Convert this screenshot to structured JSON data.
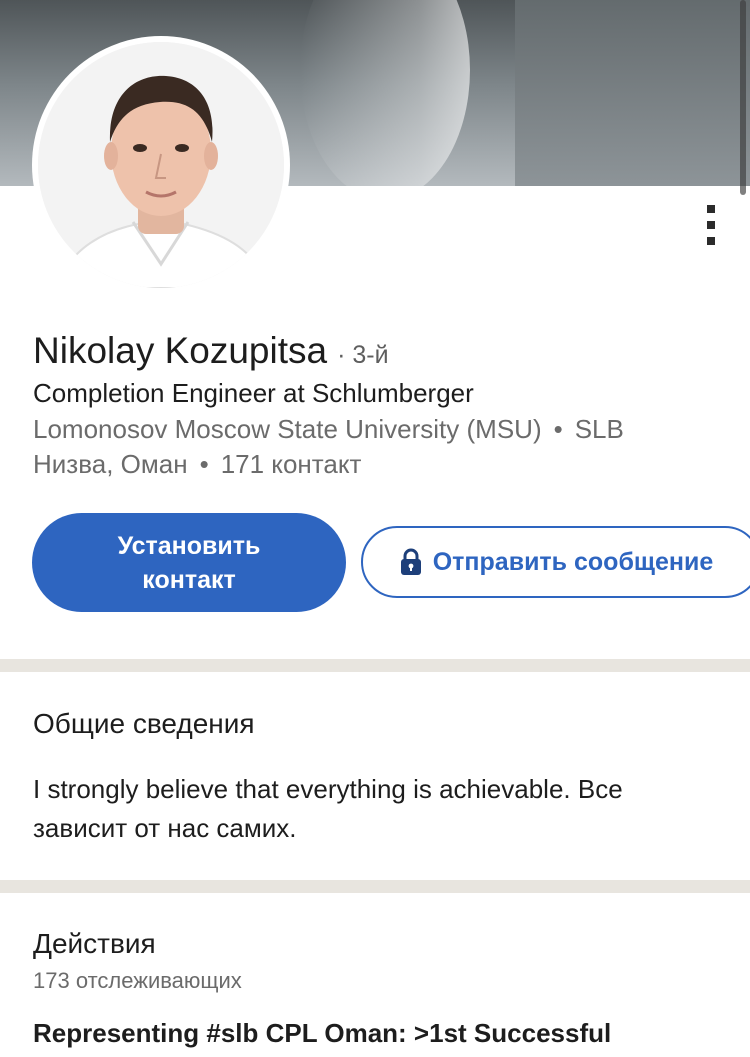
{
  "profile": {
    "name": "Nikolay Kozupitsa",
    "degree_sep": "·",
    "degree": "3-й",
    "headline": "Completion Engineer at Schlumberger",
    "education": "Lomonosov Moscow State University (MSU)",
    "company": "SLB",
    "location": "Низва, Оман",
    "connections": "171 контакт",
    "bullet": "•"
  },
  "actions": {
    "connect_label": "Установить контакт",
    "message_label": "Отправить сообщение"
  },
  "about": {
    "title": "Общие сведения",
    "text": "I strongly believe that everything is achievable. Все зависит от нас самих."
  },
  "activity": {
    "title": "Действия",
    "followers": "173 отслеживающих",
    "post_preview": "Representing #slb CPL Oman: >1st Successful"
  },
  "icons": {
    "more": "more-vertical-icon",
    "lock": "lock-icon"
  },
  "colors": {
    "accent": "#2e65c0",
    "divider": "#e8e5df",
    "secondary_text": "#6b6b6b"
  }
}
